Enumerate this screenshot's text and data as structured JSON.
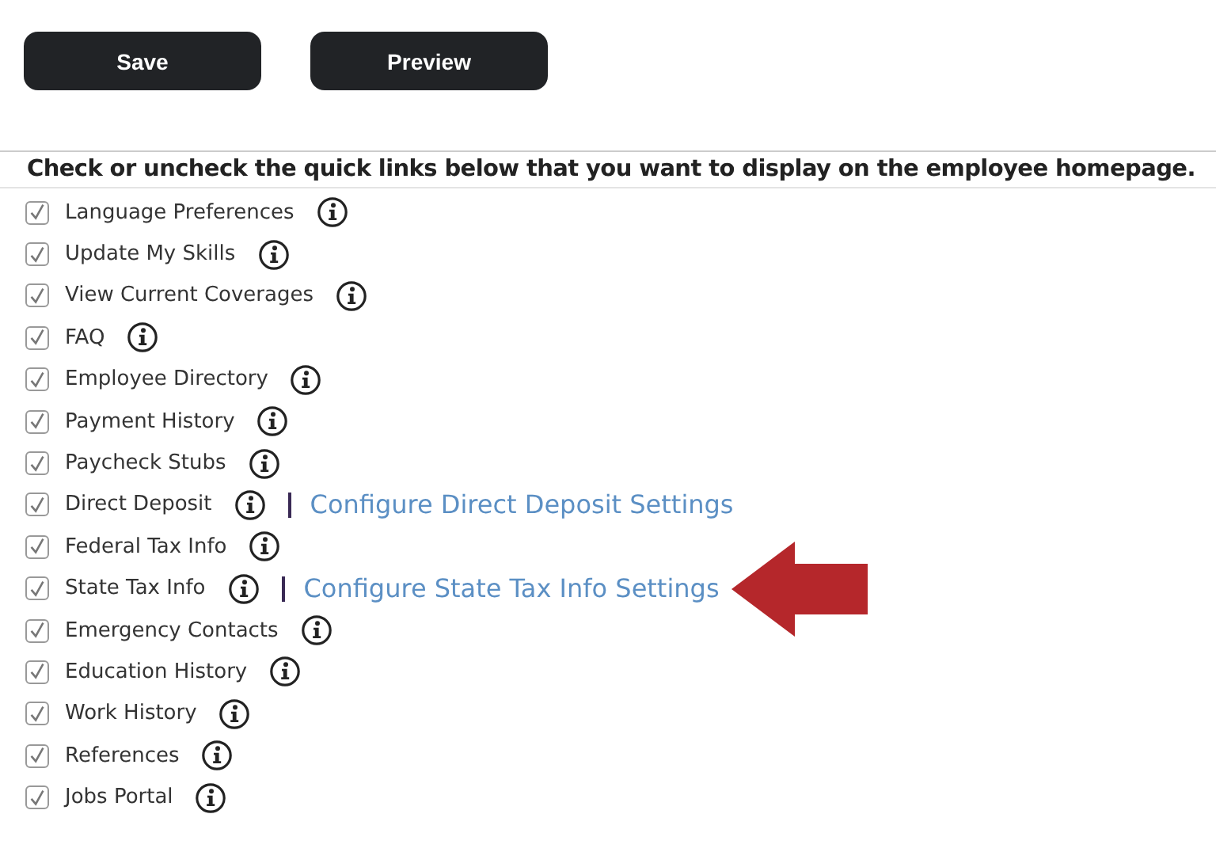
{
  "buttons": [
    {
      "label": "Save"
    },
    {
      "label": "Preview"
    }
  ],
  "instruction": "Check or uncheck the quick links below that you want to display on the employee homepage.",
  "quick_links": [
    {
      "label": "Language Preferences",
      "checked": true,
      "arrow": false
    },
    {
      "label": "Update My Skills",
      "checked": true,
      "arrow": false
    },
    {
      "label": "View Current Coverages",
      "checked": true,
      "arrow": false
    },
    {
      "label": "FAQ",
      "checked": true,
      "arrow": false
    },
    {
      "label": "Employee Directory",
      "checked": true,
      "arrow": false
    },
    {
      "label": "Payment History",
      "checked": true,
      "arrow": false
    },
    {
      "label": "Paycheck Stubs",
      "checked": true,
      "arrow": false
    },
    {
      "label": "Direct Deposit",
      "checked": true,
      "arrow": false,
      "link": "Configure Direct Deposit Settings"
    },
    {
      "label": "Federal Tax Info",
      "checked": true,
      "arrow": false
    },
    {
      "label": "State Tax Info",
      "checked": true,
      "arrow": true,
      "link": "Configure State Tax Info Settings"
    },
    {
      "label": "Emergency Contacts",
      "checked": true,
      "arrow": false
    },
    {
      "label": "Education History",
      "checked": true,
      "arrow": false
    },
    {
      "label": "Work History",
      "checked": true,
      "arrow": false
    },
    {
      "label": "References",
      "checked": true,
      "arrow": false
    },
    {
      "label": "Jobs Portal",
      "checked": true,
      "arrow": false
    }
  ]
}
